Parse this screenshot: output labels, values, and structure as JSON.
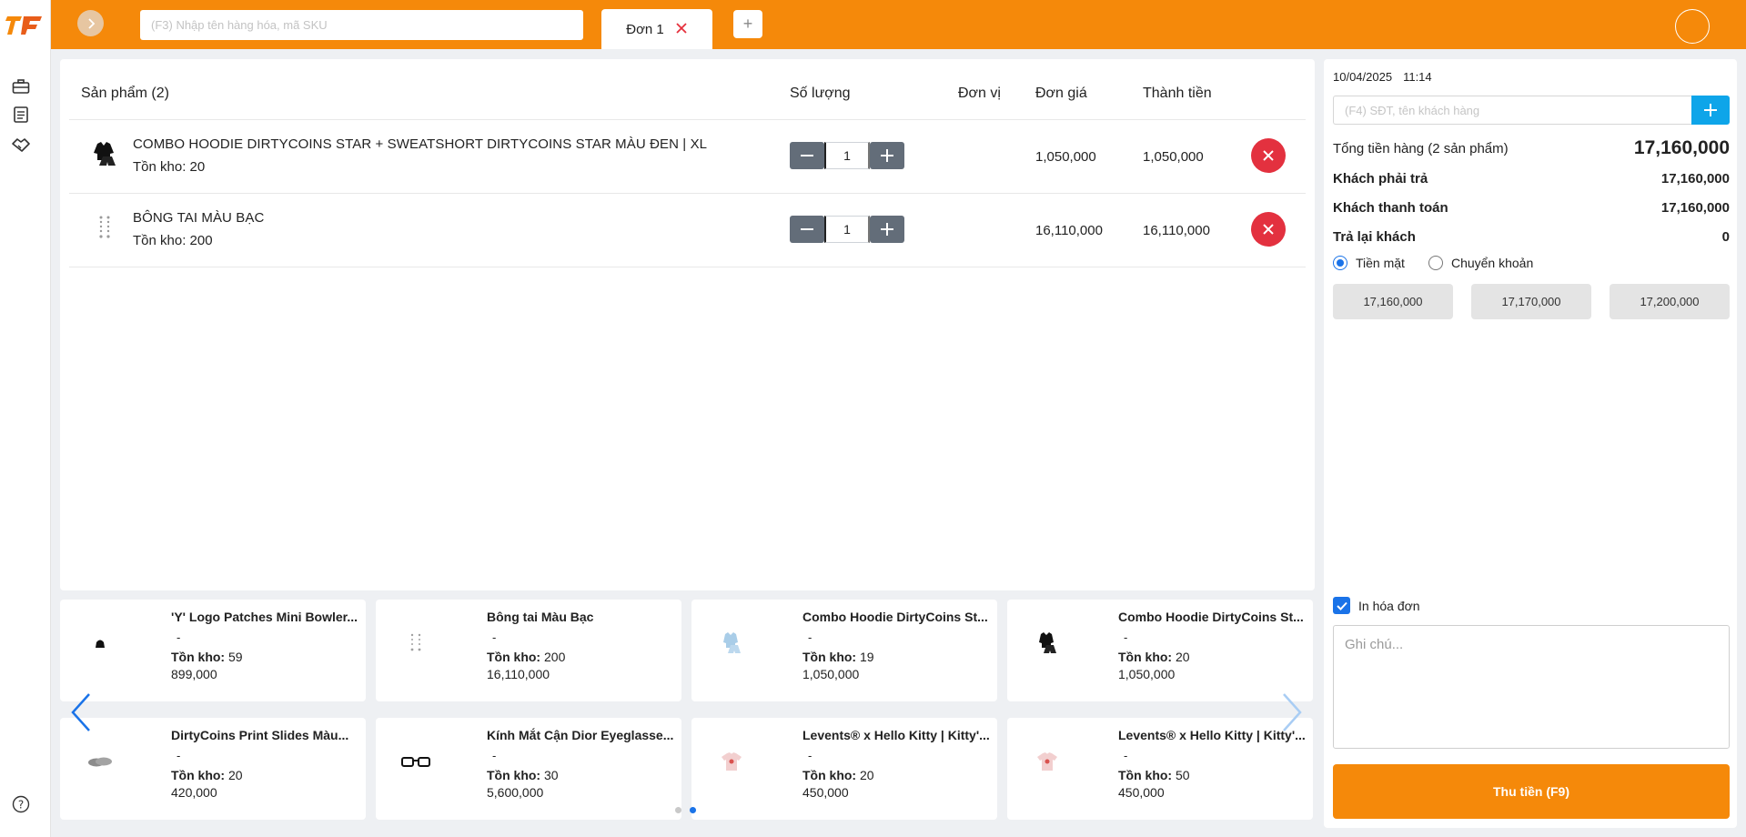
{
  "topbar": {
    "search_placeholder": "(F3) Nhập tên hàng hóa, mã SKU",
    "tab_label": "Đơn 1",
    "add_tab_label": "+"
  },
  "order": {
    "headers": {
      "product": "Sản phẩm (2)",
      "qty": "Số lượng",
      "unit": "Đơn vị",
      "price": "Đơn giá",
      "total": "Thành tiền"
    },
    "rows": [
      {
        "name": "COMBO HOODIE DIRTYCOINS STAR + SWEATSHORT DIRTYCOINS STAR MÀU ĐEN | XL",
        "stock_label": "Tồn kho:",
        "stock": "20",
        "qty": "1",
        "unit": "",
        "price": "1,050,000",
        "total": "1,050,000",
        "icon": "black-hoodie-icon"
      },
      {
        "name": "BÔNG TAI MÀU BẠC",
        "stock_label": "Tồn kho:",
        "stock": "200",
        "qty": "1",
        "unit": "",
        "price": "16,110,000",
        "total": "16,110,000",
        "icon": "silver-earring-icon"
      }
    ]
  },
  "products": [
    {
      "name": "'Y' Logo Patches Mini Bowler...",
      "dash": "-",
      "stock_label": "Tồn kho:",
      "stock": "59",
      "price": "899,000",
      "icon": "bag-icon"
    },
    {
      "name": "Bông tai Màu Bạc",
      "dash": "-",
      "stock_label": "Tồn kho:",
      "stock": "200",
      "price": "16,110,000",
      "icon": "earring-icon"
    },
    {
      "name": "Combo Hoodie DirtyCoins St...",
      "dash": "-",
      "stock_label": "Tồn kho:",
      "stock": "19",
      "price": "1,050,000",
      "icon": "blue-hoodie-icon"
    },
    {
      "name": "Combo Hoodie DirtyCoins St...",
      "dash": "-",
      "stock_label": "Tồn kho:",
      "stock": "20",
      "price": "1,050,000",
      "icon": "black-hoodie-icon"
    },
    {
      "name": "DirtyCoins Print Slides Màu...",
      "dash": "-",
      "stock_label": "Tồn kho:",
      "stock": "20",
      "price": "420,000",
      "icon": "slides-icon"
    },
    {
      "name": "Kính Mắt Cận Dior Eyeglasse...",
      "dash": "-",
      "stock_label": "Tồn kho:",
      "stock": "30",
      "price": "5,600,000",
      "icon": "glasses-icon"
    },
    {
      "name": "Levents® x Hello Kitty | Kitty'...",
      "dash": "-",
      "stock_label": "Tồn kho:",
      "stock": "20",
      "price": "450,000",
      "icon": "pink-tshirt-icon"
    },
    {
      "name": "Levents® x Hello Kitty | Kitty'...",
      "dash": "-",
      "stock_label": "Tồn kho:",
      "stock": "50",
      "price": "450,000",
      "icon": "pink-tshirt-icon"
    }
  ],
  "checkout": {
    "date": "10/04/2025",
    "time": "11:14",
    "customer_placeholder": "(F4) SĐT, tên khách hàng",
    "goods_total_label": "Tổng tiền hàng (2 sản phẩm)",
    "goods_total": "17,160,000",
    "must_pay_label": "Khách phải trả",
    "must_pay": "17,160,000",
    "paid_label": "Khách thanh toán",
    "paid": "17,160,000",
    "change_label": "Trả lại khách",
    "change": "0",
    "cash_label": "Tiền mặt",
    "transfer_label": "Chuyển khoản",
    "quick_amounts": [
      "17,160,000",
      "17,170,000",
      "17,200,000"
    ],
    "print_label": "In hóa đơn",
    "note_placeholder": "Ghi chú...",
    "pay_button": "Thu tiền (F9)"
  },
  "colors": {
    "brand_orange": "#f5890a",
    "danger": "#e3313f",
    "accent_blue": "#1a73e8"
  }
}
